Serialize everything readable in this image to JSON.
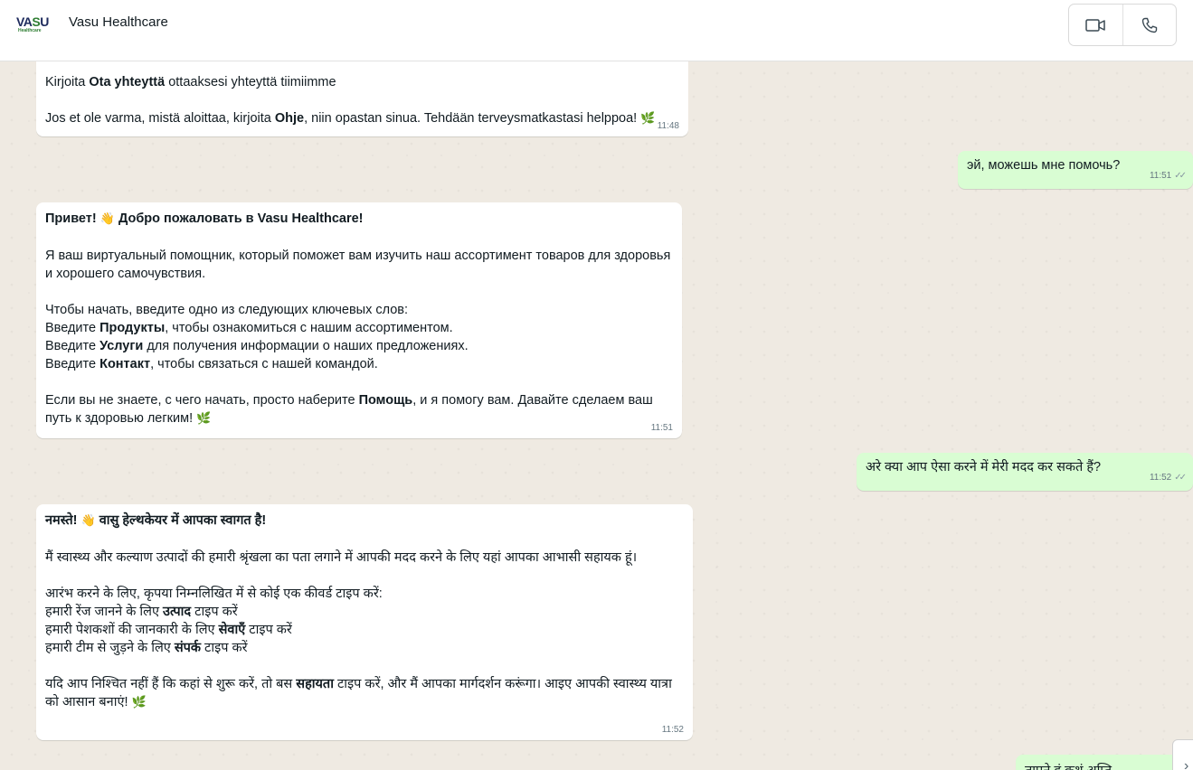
{
  "header": {
    "logo_main_a": "VA",
    "logo_main_b": "S",
    "logo_main_c": "U",
    "logo_sub": "Healthcare",
    "title": "Vasu Healthcare",
    "video_icon": "video-camera-icon",
    "phone_icon": "phone-icon"
  },
  "messages": {
    "m1": {
      "line1_pre": "Kirjoita ",
      "line1_bold": "Ota yhteyttä",
      "line1_post": " ottaaksesi yhteyttä tiimiimme",
      "line2_pre": "Jos et ole varma, mistä aloittaa, kirjoita ",
      "line2_bold": "Ohje",
      "line2_post": ", niin opastan sinua. Tehdään terveysmatkastasi helppoa! ",
      "time": "11:48"
    },
    "m2": {
      "text": "эй, можешь мне помочь?",
      "time": "11:51"
    },
    "m3": {
      "greet_a": "Привет! ",
      "greet_b": " Добро пожаловать в Vasu Healthcare!",
      "intro": "Я ваш виртуальный помощник, который поможет вам изучить наш ассортимент товаров для здоровья и хорошего самочувствия.",
      "start": "Чтобы начать, введите одно из следующих ключевых слов:",
      "k1_pre": "Введите ",
      "k1_bold": "Продукты",
      "k1_post": ", чтобы ознакомиться с нашим ассортиментом.",
      "k2_pre": "Введите ",
      "k2_bold": "Услуги",
      "k2_post": " для получения информации о наших предложениях.",
      "k3_pre": "Введите ",
      "k3_bold": "Контакт",
      "k3_post": ", чтобы связаться с нашей командой.",
      "help_pre": "Если вы не знаете, с чего начать, просто наберите ",
      "help_bold": "Помощь",
      "help_post": ", и я помогу вам. Давайте сделаем ваш путь к здоровью легким! ",
      "time": "11:51"
    },
    "m4": {
      "text": "अरे क्या आप ऐसा करने में मेरी मदद कर सकते हैं?",
      "time": "11:52"
    },
    "m5": {
      "greet_a": "नमस्ते! ",
      "greet_b": " वासु हेल्थकेयर में आपका स्वागत है!",
      "intro": "मैं स्वास्थ्य और कल्याण उत्पादों की हमारी श्रृंखला का पता लगाने में आपकी मदद करने के लिए यहां आपका आभासी सहायक हूं।",
      "start": "आरंभ करने के लिए, कृपया निम्नलिखित में से कोई एक कीवर्ड टाइप करें:",
      "k1_pre": "हमारी रेंज जानने के लिए ",
      "k1_bold": "उत्पाद",
      "k1_post": " टाइप करें",
      "k2_pre": "हमारी पेशकशों की जानकारी के लिए ",
      "k2_bold": "सेवाएँ",
      "k2_post": " टाइप करें",
      "k3_pre": "हमारी टीम से जुड़ने के लिए ",
      "k3_bold": "संपर्क",
      "k3_post": " टाइप करें",
      "help_pre": "यदि आप निश्चित नहीं हैं कि कहां से शुरू करें, तो बस ",
      "help_bold": "सहायता",
      "help_post": " टाइप करें, और मैं आपका मार्गदर्शन करूंगा। आइए आपकी स्वास्थ्य यात्रा को आसान बनाएं! ",
      "time": "11:52"
    },
    "m6": {
      "text": "तापने हं कथं अप्ति"
    }
  },
  "glyphs": {
    "leaf": "🌿",
    "wave": "👋",
    "ticks": "✓✓",
    "chevron": "›"
  },
  "colors": {
    "outgoing_bubble": "#d9fdd3",
    "incoming_bubble": "#ffffff",
    "chat_background": "#efeae2"
  }
}
